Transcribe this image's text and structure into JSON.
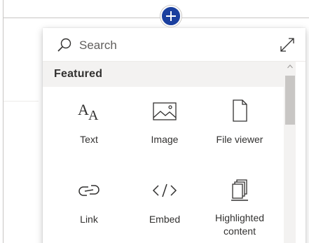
{
  "toolbox": {
    "search_placeholder": "Search",
    "section_title": "Featured",
    "items": [
      {
        "label": "Text",
        "icon": "text-icon"
      },
      {
        "label": "Image",
        "icon": "image-icon"
      },
      {
        "label": "File viewer",
        "icon": "file-viewer-icon"
      },
      {
        "label": "Link",
        "icon": "link-icon"
      },
      {
        "label": "Embed",
        "icon": "embed-icon"
      },
      {
        "label": "Highlighted content",
        "icon": "highlighted-content-icon"
      }
    ]
  },
  "colors": {
    "accent": "#1a3f9e",
    "section_background": "#f3f2f1",
    "text": "#323130"
  }
}
